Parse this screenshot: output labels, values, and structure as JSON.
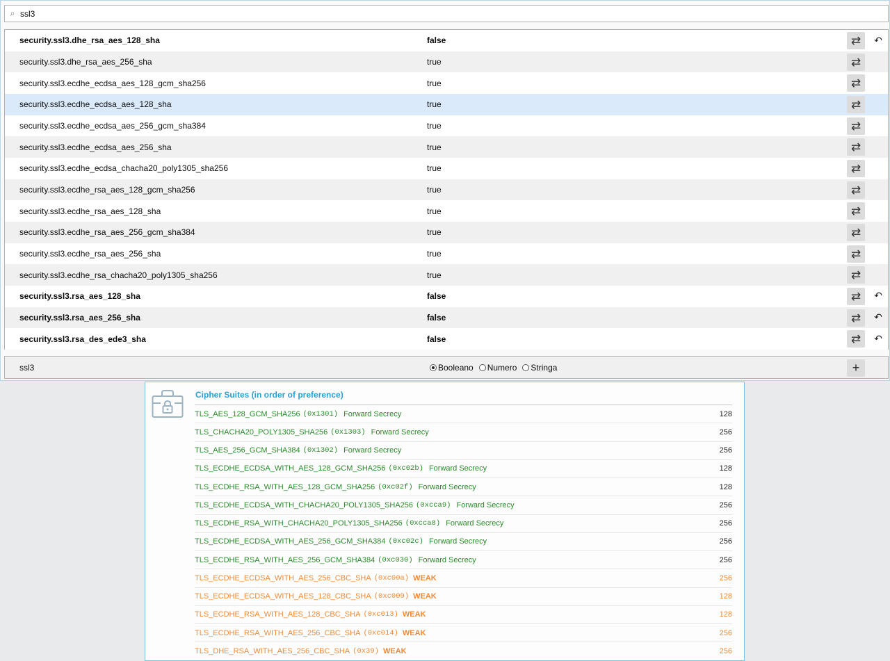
{
  "search": {
    "icon": "search-icon",
    "value": "ssl3"
  },
  "prefs": [
    {
      "name": "security.ssl3.dhe_rsa_aes_128_sha",
      "value": "false",
      "modified": true
    },
    {
      "name": "security.ssl3.dhe_rsa_aes_256_sha",
      "value": "true",
      "modified": false
    },
    {
      "name": "security.ssl3.ecdhe_ecdsa_aes_128_gcm_sha256",
      "value": "true",
      "modified": false
    },
    {
      "name": "security.ssl3.ecdhe_ecdsa_aes_128_sha",
      "value": "true",
      "modified": false,
      "highlighted": true
    },
    {
      "name": "security.ssl3.ecdhe_ecdsa_aes_256_gcm_sha384",
      "value": "true",
      "modified": false
    },
    {
      "name": "security.ssl3.ecdhe_ecdsa_aes_256_sha",
      "value": "true",
      "modified": false
    },
    {
      "name": "security.ssl3.ecdhe_ecdsa_chacha20_poly1305_sha256",
      "value": "true",
      "modified": false
    },
    {
      "name": "security.ssl3.ecdhe_rsa_aes_128_gcm_sha256",
      "value": "true",
      "modified": false
    },
    {
      "name": "security.ssl3.ecdhe_rsa_aes_128_sha",
      "value": "true",
      "modified": false
    },
    {
      "name": "security.ssl3.ecdhe_rsa_aes_256_gcm_sha384",
      "value": "true",
      "modified": false
    },
    {
      "name": "security.ssl3.ecdhe_rsa_aes_256_sha",
      "value": "true",
      "modified": false
    },
    {
      "name": "security.ssl3.ecdhe_rsa_chacha20_poly1305_sha256",
      "value": "true",
      "modified": false
    },
    {
      "name": "security.ssl3.rsa_aes_128_sha",
      "value": "false",
      "modified": true
    },
    {
      "name": "security.ssl3.rsa_aes_256_sha",
      "value": "false",
      "modified": true
    },
    {
      "name": "security.ssl3.rsa_des_ede3_sha",
      "value": "false",
      "modified": true
    }
  ],
  "toggle_icon": "⇄",
  "reset_icon": "↶",
  "add_row": {
    "name": "ssl3",
    "types": [
      "Booleano",
      "Numero",
      "Stringa"
    ],
    "selected_type": "Booleano",
    "add_icon": "+"
  },
  "cipher_panel": {
    "title": "Cipher Suites (in order of preference)",
    "suites": [
      {
        "name": "TLS_AES_128_GCM_SHA256",
        "code": "(0x1301)",
        "tag": "Forward Secrecy",
        "bits": "128",
        "weak": false
      },
      {
        "name": "TLS_CHACHA20_POLY1305_SHA256",
        "code": "(0x1303)",
        "tag": "Forward Secrecy",
        "bits": "256",
        "weak": false
      },
      {
        "name": "TLS_AES_256_GCM_SHA384",
        "code": "(0x1302)",
        "tag": "Forward Secrecy",
        "bits": "256",
        "weak": false
      },
      {
        "name": "TLS_ECDHE_ECDSA_WITH_AES_128_GCM_SHA256",
        "code": "(0xc02b)",
        "tag": "Forward Secrecy",
        "bits": "128",
        "weak": false
      },
      {
        "name": "TLS_ECDHE_RSA_WITH_AES_128_GCM_SHA256",
        "code": "(0xc02f)",
        "tag": "Forward Secrecy",
        "bits": "128",
        "weak": false
      },
      {
        "name": "TLS_ECDHE_ECDSA_WITH_CHACHA20_POLY1305_SHA256",
        "code": "(0xcca9)",
        "tag": "Forward Secrecy",
        "bits": "256",
        "weak": false
      },
      {
        "name": "TLS_ECDHE_RSA_WITH_CHACHA20_POLY1305_SHA256",
        "code": "(0xcca8)",
        "tag": "Forward Secrecy",
        "bits": "256",
        "weak": false
      },
      {
        "name": "TLS_ECDHE_ECDSA_WITH_AES_256_GCM_SHA384",
        "code": "(0xc02c)",
        "tag": "Forward Secrecy",
        "bits": "256",
        "weak": false
      },
      {
        "name": "TLS_ECDHE_RSA_WITH_AES_256_GCM_SHA384",
        "code": "(0xc030)",
        "tag": "Forward Secrecy",
        "bits": "256",
        "weak": false
      },
      {
        "name": "TLS_ECDHE_ECDSA_WITH_AES_256_CBC_SHA",
        "code": "(0xc00a)",
        "tag": "WEAK",
        "bits": "256",
        "weak": true
      },
      {
        "name": "TLS_ECDHE_ECDSA_WITH_AES_128_CBC_SHA",
        "code": "(0xc009)",
        "tag": "WEAK",
        "bits": "128",
        "weak": true
      },
      {
        "name": "TLS_ECDHE_RSA_WITH_AES_128_CBC_SHA",
        "code": "(0xc013)",
        "tag": "WEAK",
        "bits": "128",
        "weak": true
      },
      {
        "name": "TLS_ECDHE_RSA_WITH_AES_256_CBC_SHA",
        "code": "(0xc014)",
        "tag": "WEAK",
        "bits": "256",
        "weak": true
      },
      {
        "name": "TLS_DHE_RSA_WITH_AES_256_CBC_SHA",
        "code": "(0x39)",
        "tag": "WEAK",
        "bits": "256",
        "weak": true
      }
    ]
  },
  "colors": {
    "good": "#2a8a2a",
    "weak": "#ef8a3a",
    "title": "#2a9fd6",
    "highlight": "#daeafa"
  }
}
